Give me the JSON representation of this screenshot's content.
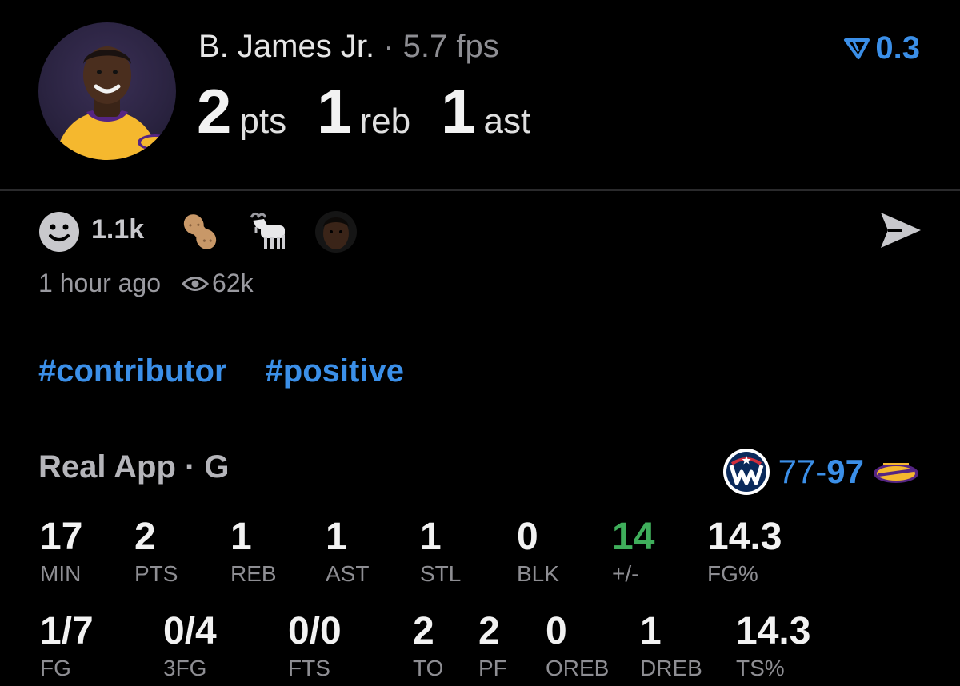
{
  "header": {
    "player_name": "B. James Jr.",
    "separator": "·",
    "fps": "5.7 fps",
    "rating": "0.3",
    "statline": [
      {
        "value": "2",
        "unit": "pts"
      },
      {
        "value": "1",
        "unit": "reb"
      },
      {
        "value": "1",
        "unit": "ast"
      }
    ],
    "avatar_icon": "player-headshot-lakers"
  },
  "reactions": {
    "count": "1.1k",
    "items": [
      "peanut-icon",
      "goat-icon",
      "player-face-icon"
    ],
    "share_icon": "send-icon"
  },
  "meta": {
    "time_ago": "1 hour ago",
    "views": "62k"
  },
  "tags": [
    "#contributor",
    "#positive"
  ],
  "game": {
    "title": "Real App · G",
    "score_away": "77",
    "score_dash": "-",
    "score_home": "97",
    "away_team_icon": "wizards-logo",
    "home_team_icon": "lakers-logo"
  },
  "stats_row1": [
    {
      "value": "17",
      "label": "MIN"
    },
    {
      "value": "2",
      "label": "PTS"
    },
    {
      "value": "1",
      "label": "REB"
    },
    {
      "value": "1",
      "label": "AST"
    },
    {
      "value": "1",
      "label": "STL"
    },
    {
      "value": "0",
      "label": "BLK"
    },
    {
      "value": "14",
      "label": "+/-"
    },
    {
      "value": "14.3",
      "label": "FG%"
    }
  ],
  "stats_row2": [
    {
      "value": "1/7",
      "label": "FG"
    },
    {
      "value": "0/4",
      "label": "3FG"
    },
    {
      "value": "0/0",
      "label": "FTS"
    },
    {
      "value": "2",
      "label": "TO"
    },
    {
      "value": "2",
      "label": "PF"
    },
    {
      "value": "0",
      "label": "OREB"
    },
    {
      "value": "1",
      "label": "DREB"
    },
    {
      "value": "14.3",
      "label": "TS%"
    }
  ],
  "colors": {
    "accent_blue": "#3b8fe8",
    "positive_green": "#3fae5b",
    "background": "#000000",
    "lakers_gold": "#f5b82e",
    "lakers_purple": "#552583",
    "wizards_navy": "#0b2a5b",
    "wizards_red": "#d12e3c"
  }
}
